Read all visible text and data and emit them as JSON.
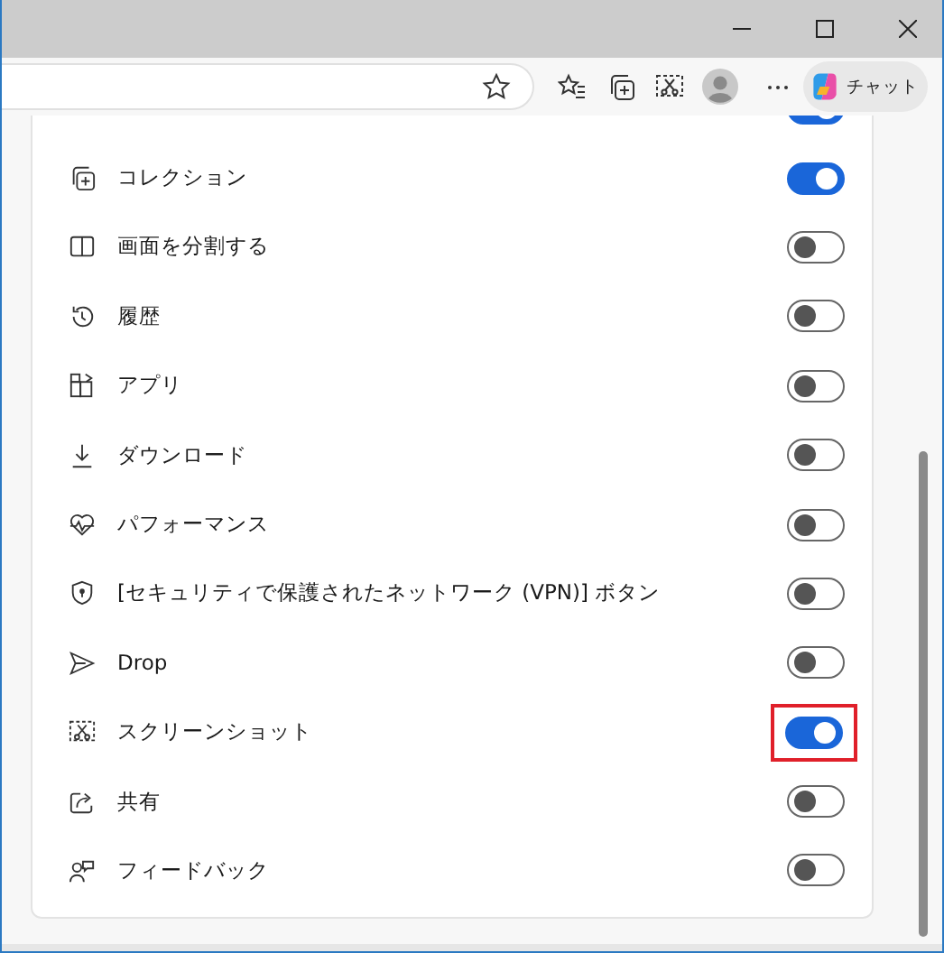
{
  "toolbar": {
    "chat_button": "チャット"
  },
  "items": [
    {
      "on": true
    },
    {
      "label": "コレクション",
      "on": true
    },
    {
      "label": "画面を分割する",
      "on": false
    },
    {
      "label": "履歴",
      "on": false
    },
    {
      "label": "アプリ",
      "on": false
    },
    {
      "label": "ダウンロード",
      "on": false
    },
    {
      "label": "パフォーマンス",
      "on": false
    },
    {
      "label": "[セキュリティで保護されたネットワーク (VPN)] ボタン",
      "on": false
    },
    {
      "label": "Drop",
      "on": false
    },
    {
      "label": "スクリーンショット",
      "on": true,
      "highlighted": true
    },
    {
      "label": "共有",
      "on": false
    },
    {
      "label": "フィードバック",
      "on": false
    }
  ]
}
